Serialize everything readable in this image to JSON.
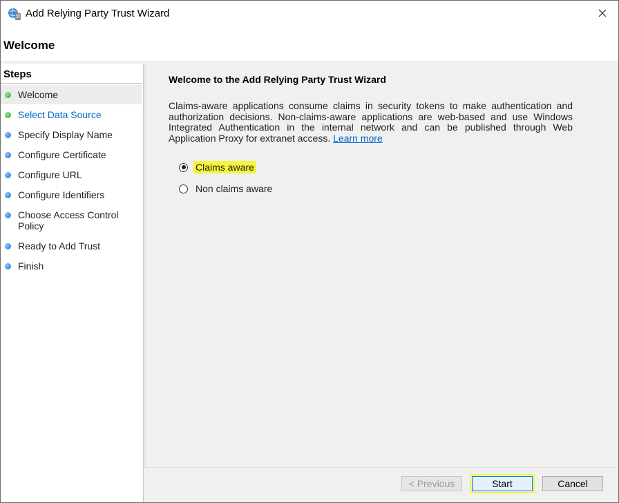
{
  "window": {
    "title": "Add Relying Party Trust Wizard"
  },
  "header": {
    "title": "Welcome"
  },
  "steps": {
    "heading": "Steps",
    "items": [
      {
        "label": "Welcome",
        "status": "green"
      },
      {
        "label": "Select Data Source",
        "status": "green"
      },
      {
        "label": "Specify Display Name",
        "status": "blue"
      },
      {
        "label": "Configure Certificate",
        "status": "blue"
      },
      {
        "label": "Configure URL",
        "status": "blue"
      },
      {
        "label": "Configure Identifiers",
        "status": "blue"
      },
      {
        "label": "Choose Access Control",
        "label2": "Policy",
        "status": "blue"
      },
      {
        "label": "Ready to Add Trust",
        "status": "blue"
      },
      {
        "label": "Finish",
        "status": "blue"
      }
    ]
  },
  "main": {
    "title": "Welcome to the Add Relying Party Trust Wizard",
    "description": "Claims-aware applications consume claims in security tokens to make authentication and authorization decisions. Non-claims-aware applications are web-based and use Windows Integrated Authentication in the internal network and can be published through Web Application Proxy for extranet access.",
    "learn_more": "Learn more",
    "options": [
      {
        "label": "Claims aware",
        "checked": true
      },
      {
        "label": "Non claims aware",
        "checked": false
      }
    ]
  },
  "buttons": {
    "previous": "< Previous",
    "start": "Start",
    "cancel": "Cancel"
  },
  "colors": {
    "highlight": "#f5f53a",
    "link": "#0066cc",
    "step_done": "#2aa12a",
    "step_pending": "#1a6fd6"
  }
}
